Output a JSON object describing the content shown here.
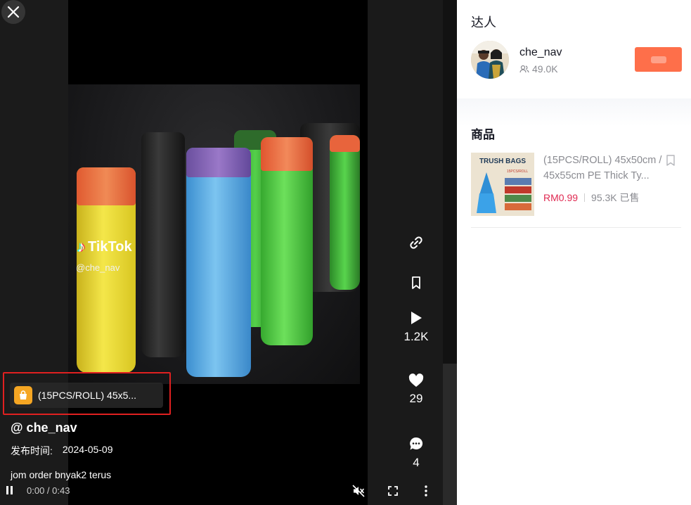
{
  "video": {
    "watermark_brand": "TikTok",
    "watermark_handle": "@che_nav",
    "product_pill_label": "(15PCS/ROLL) 45x5...",
    "author_handle": "@ che_nav",
    "publish_label": "发布时间:",
    "publish_date": "2024-05-09",
    "caption": "jom order bnyak2 terus",
    "time": "0:00 / 0:43",
    "rail": {
      "play_count": "1.2K",
      "like_count": "29",
      "comment_count": "4"
    }
  },
  "side": {
    "creator_section_title": "达人",
    "creator_name": "che_nav",
    "creator_followers": "49.0K",
    "product_section_title": "商品",
    "product": {
      "title": "(15PCS/ROLL) 45x50cm / 45x55cm PE Thick Ty...",
      "price": "RM0.99",
      "sold": "95.3K 已售",
      "thumb_heading": "TRUSH BAGS",
      "thumb_sub": "15PCS/ROLL"
    }
  },
  "colors": {
    "accent": "#fe6f4a",
    "price": "#e02a52",
    "highlight_box": "#e02020",
    "bag_icon": "#f5a623"
  },
  "icons": [
    "close-icon",
    "link-icon",
    "bookmark-icon",
    "play-icon",
    "heart-icon",
    "comment-icon",
    "pause-icon",
    "mute-icon",
    "fullscreen-icon",
    "more-icon",
    "shopping-bag-icon",
    "followers-icon"
  ]
}
